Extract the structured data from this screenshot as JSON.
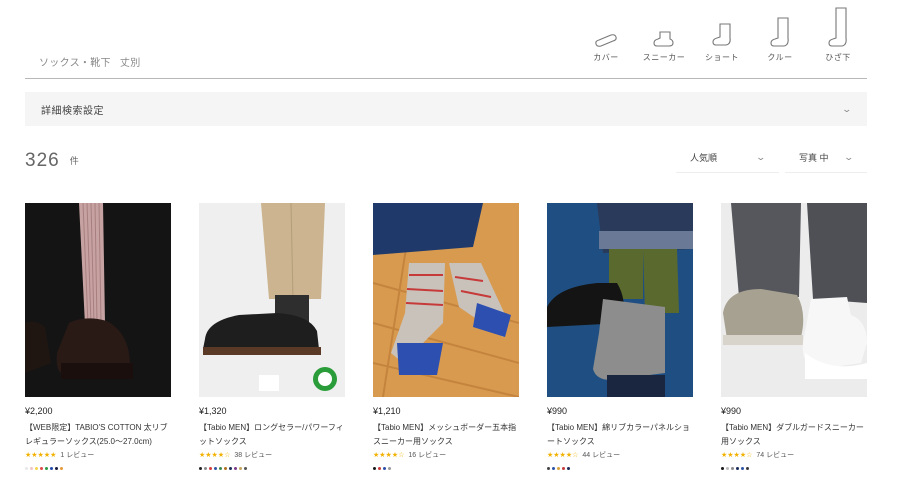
{
  "breadcrumb": {
    "category": "ソックス・靴下",
    "current": "丈別"
  },
  "length_nav": [
    {
      "label": "カバー",
      "icon": "cover-sock-icon"
    },
    {
      "label": "スニーカー",
      "icon": "sneaker-sock-icon"
    },
    {
      "label": "ショート",
      "icon": "short-sock-icon"
    },
    {
      "label": "クルー",
      "icon": "crew-sock-icon"
    },
    {
      "label": "ひざ下",
      "icon": "knee-sock-icon"
    }
  ],
  "advanced_search": {
    "label": "詳細検索設定"
  },
  "results": {
    "count": "326",
    "unit": "件"
  },
  "sort": {
    "selected": "人気順"
  },
  "photo_size": {
    "selected": "写真 中"
  },
  "products": [
    {
      "price": "¥2,200",
      "name": "【WEB限定】TABIO'S COTTON 太リブレギュラーソックス(25.0～27.0cm)",
      "reviews": "1 レビュー",
      "stars": "★★★★★",
      "swatch_colors": [
        "#e8e8e8",
        "#f0c6c6",
        "#f5d74a",
        "#e04848",
        "#2a9a46",
        "#1e4aa8",
        "#1a1a3c",
        "#e59a3a"
      ]
    },
    {
      "price": "¥1,320",
      "name": "【Tabio MEN】ロングセラー/パワーフィットソックス",
      "reviews": "38 レビュー",
      "stars": "★★★★☆",
      "swatch_colors": [
        "#222222",
        "#8a8a8a",
        "#d23a3a",
        "#2d55a5",
        "#3a8a4a",
        "#b0701e",
        "#1a2b5a",
        "#7a3a8a",
        "#c4a35a",
        "#555555"
      ]
    },
    {
      "price": "¥1,210",
      "name": "【Tabio MEN】メッシュボーダー五本指スニーカー用ソックス",
      "reviews": "16 レビュー",
      "stars": "★★★★☆",
      "swatch_colors": [
        "#1a1a1a",
        "#c93a3a",
        "#2b4fa8",
        "#9a9a9a"
      ]
    },
    {
      "price": "¥990",
      "name": "【Tabio MEN】綿リブカラーパネルショートソックス",
      "reviews": "44 レビュー",
      "stars": "★★★★☆",
      "swatch_colors": [
        "#444444",
        "#2d55a5",
        "#d9a43a",
        "#c93a3a",
        "#1a2b5a"
      ]
    },
    {
      "price": "¥990",
      "name": "【Tabio MEN】ダブルガードスニーカー用ソックス",
      "reviews": "74 レビュー",
      "stars": "★★★★☆",
      "swatch_colors": [
        "#1a1a1a",
        "#bbbbbb",
        "#8a8a8a",
        "#1a2b5a",
        "#2d55a5",
        "#3a3a3a"
      ]
    }
  ]
}
